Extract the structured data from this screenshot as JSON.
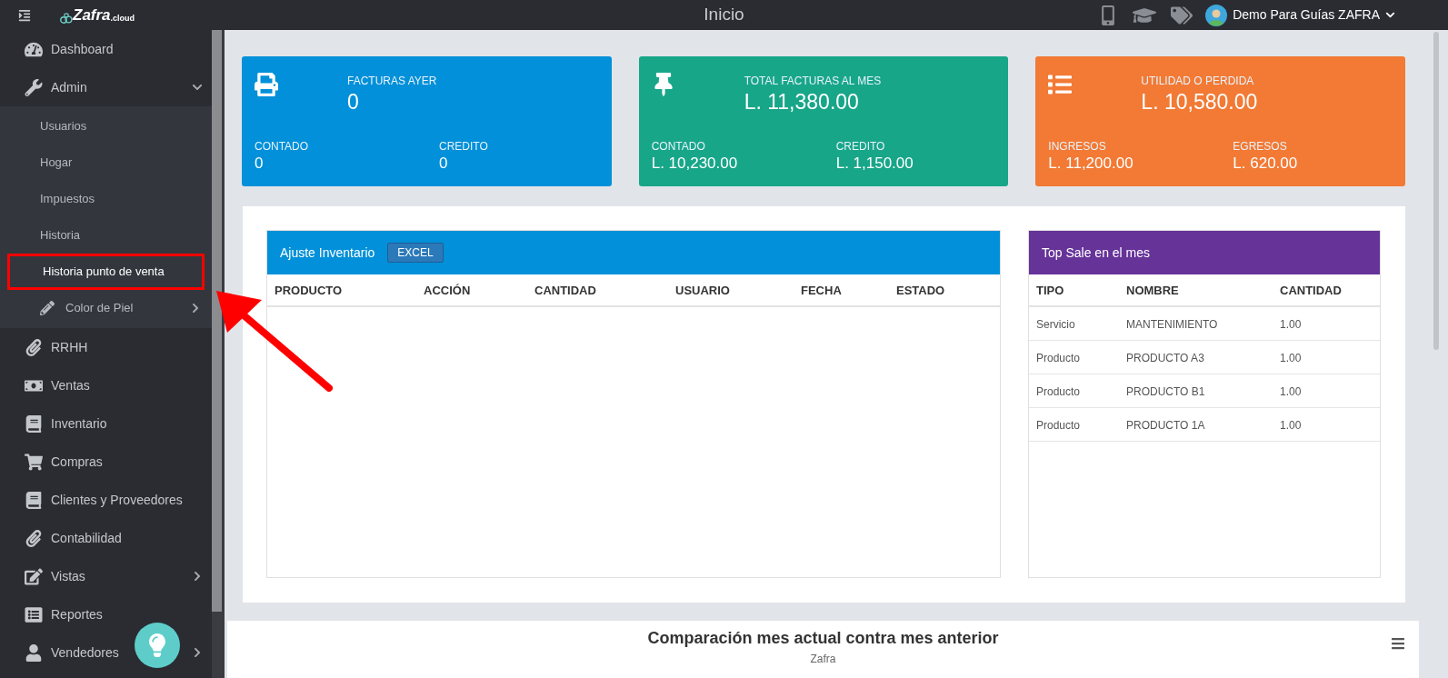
{
  "topbar": {
    "brand": "Zafra",
    "brand_suffix": ".cloud",
    "title": "Inicio",
    "user": "Demo Para Guías ZAFRA"
  },
  "sidebar": {
    "items": [
      {
        "label": "Dashboard"
      },
      {
        "label": "Admin",
        "expanded": true,
        "children": [
          {
            "label": "Usuarios",
            "selected": false,
            "highlighted": false
          },
          {
            "label": "Hogar",
            "selected": false,
            "highlighted": false
          },
          {
            "label": "Impuestos",
            "selected": false,
            "highlighted": false
          },
          {
            "label": "Historia",
            "selected": false,
            "highlighted": false
          },
          {
            "label": "Historia punto de venta",
            "selected": true,
            "highlighted": true
          },
          {
            "label": "Color de Piel",
            "selected": false,
            "highlighted": false,
            "expanded": false
          }
        ]
      },
      {
        "label": "RRHH"
      },
      {
        "label": "Ventas"
      },
      {
        "label": "Inventario"
      },
      {
        "label": "Compras"
      },
      {
        "label": "Clientes y Proveedores"
      },
      {
        "label": "Contabilidad"
      },
      {
        "label": "Vistas",
        "expanded": false
      },
      {
        "label": "Reportes"
      },
      {
        "label": "Vendedores",
        "expanded": false
      }
    ]
  },
  "stat_cards": [
    {
      "color": "#0190d9",
      "title": "FACTURAS AYER",
      "value": "0",
      "left_label": "CONTADO",
      "left_value": "0",
      "right_label": "CREDITO",
      "right_value": "0"
    },
    {
      "color": "#18a689",
      "title": "TOTAL FACTURAS AL MES",
      "value": "L. 11,380.00",
      "left_label": "CONTADO",
      "left_value": "L. 10,230.00",
      "right_label": "CREDITO",
      "right_value": "L. 1,150.00"
    },
    {
      "color": "#f27a35",
      "title": "UTILIDAD O PERDIDA",
      "value": "L. 10,580.00",
      "left_label": "INGRESOS",
      "left_value": "L. 11,200.00",
      "right_label": "EGRESOS",
      "right_value": "L. 620.00"
    }
  ],
  "inventory_panel": {
    "title": "Ajuste Inventario",
    "export_button": "EXCEL",
    "columns": [
      "PRODUCTO",
      "ACCIÓN",
      "CANTIDAD",
      "USUARIO",
      "FECHA",
      "ESTADO"
    ]
  },
  "top_sale_panel": {
    "title": "Top Sale en el mes",
    "columns": [
      "TIPO",
      "NOMBRE",
      "CANTIDAD"
    ],
    "rows": [
      [
        "Servicio",
        "MANTENIMIENTO",
        "1.00"
      ],
      [
        "Producto",
        "PRODUCTO A3",
        "1.00"
      ],
      [
        "Producto",
        "PRODUCTO B1",
        "1.00"
      ],
      [
        "Producto",
        "PRODUCTO 1A",
        "1.00"
      ]
    ]
  },
  "chart_panel": {
    "title": "Comparación mes actual contra mes anterior",
    "subtitle": "Zafra"
  }
}
